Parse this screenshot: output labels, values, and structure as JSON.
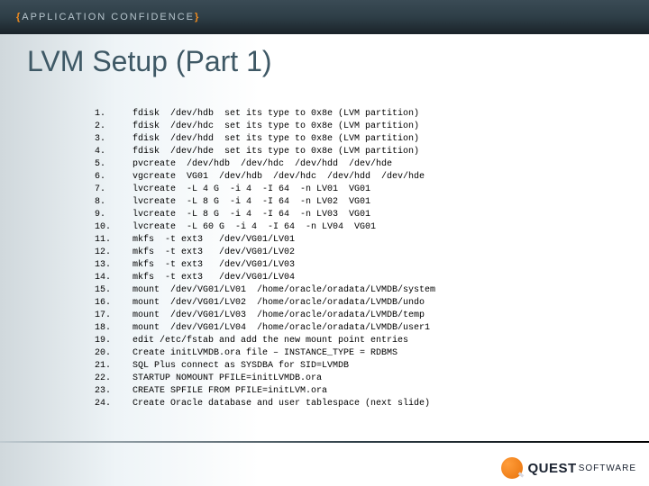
{
  "header": {
    "confidentiality": "APPLICATION CONFIDENCE"
  },
  "title": "LVM Setup (Part 1)",
  "steps": [
    "fdisk  /dev/hdb  set its type to 0x8e (LVM partition)",
    "fdisk  /dev/hdc  set its type to 0x8e (LVM partition)",
    "fdisk  /dev/hdd  set its type to 0x8e (LVM partition)",
    "fdisk  /dev/hde  set its type to 0x8e (LVM partition)",
    "pvcreate  /dev/hdb  /dev/hdc  /dev/hdd  /dev/hde",
    "vgcreate  VG01  /dev/hdb  /dev/hdc  /dev/hdd  /dev/hde",
    "lvcreate  -L 4 G  -i 4  -I 64  -n LV01  VG01",
    "lvcreate  -L 8 G  -i 4  -I 64  -n LV02  VG01",
    "lvcreate  -L 8 G  -i 4  -I 64  -n LV03  VG01",
    "lvcreate  -L 60 G  -i 4  -I 64  -n LV04  VG01",
    "mkfs  -t ext3   /dev/VG01/LV01",
    "mkfs  -t ext3   /dev/VG01/LV02",
    "mkfs  -t ext3   /dev/VG01/LV03",
    "mkfs  -t ext3   /dev/VG01/LV04",
    "mount  /dev/VG01/LV01  /home/oracle/oradata/LVMDB/system",
    "mount  /dev/VG01/LV02  /home/oracle/oradata/LVMDB/undo",
    "mount  /dev/VG01/LV03  /home/oracle/oradata/LVMDB/temp",
    "mount  /dev/VG01/LV04  /home/oracle/oradata/LVMDB/user1",
    "edit /etc/fstab and add the new mount point entries",
    "Create initLVMDB.ora file – INSTANCE_TYPE = RDBMS",
    "SQL Plus connect as SYSDBA for SID=LVMDB",
    "STARTUP NOMOUNT PFILE=initLVMDB.ora",
    "CREATE SPFILE FROM PFILE=initLVM.ora",
    "Create Oracle database and user tablespace (next slide)"
  ],
  "footer": {
    "logo_main": "QUEST",
    "logo_sub": "SOFTWARE"
  }
}
